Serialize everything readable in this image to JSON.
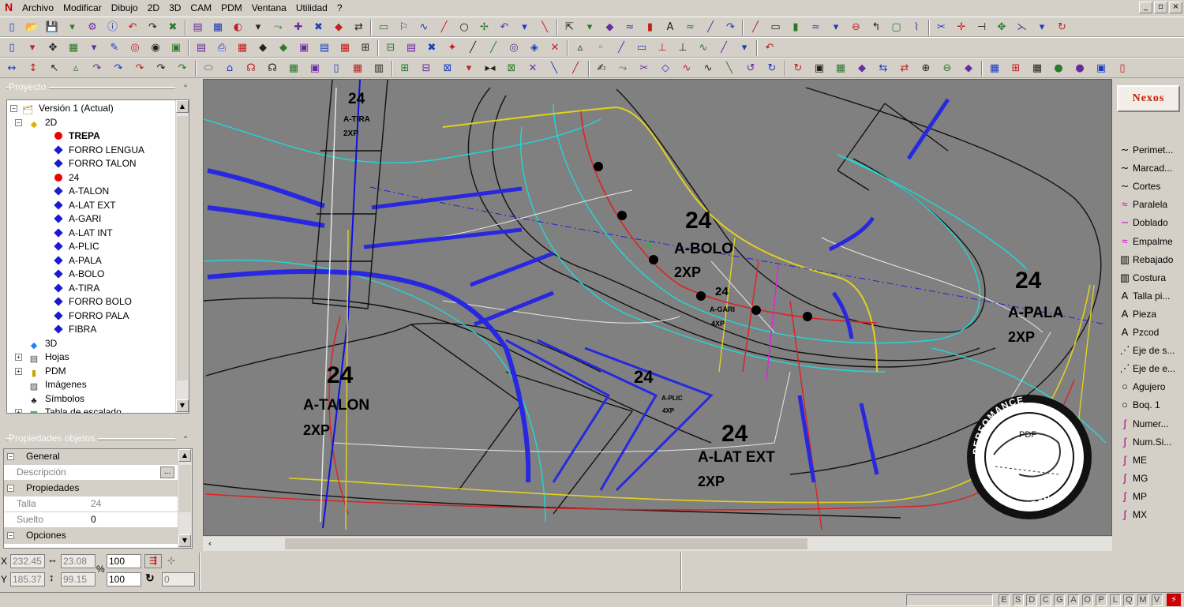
{
  "menu": [
    "Archivo",
    "Modificar",
    "Dibujo",
    "2D",
    "3D",
    "CAM",
    "PDM",
    "Ventana",
    "Utilidad",
    "?"
  ],
  "app_logo_glyph": "N",
  "panels": {
    "project_title": "Proyecto",
    "props_title": "Propiedades objetos"
  },
  "tree": [
    {
      "label": "Versión 1 (Actual)",
      "kind": "version",
      "depth": 0
    },
    {
      "label": "2D",
      "kind": "folder2d",
      "depth": 1
    },
    {
      "label": "TREPA",
      "kind": "circle",
      "depth": 2,
      "bold": true
    },
    {
      "label": "FORRO LENGUA",
      "kind": "diamond",
      "depth": 2
    },
    {
      "label": "FORRO TALON",
      "kind": "diamond",
      "depth": 2
    },
    {
      "label": "24",
      "kind": "circle",
      "depth": 2
    },
    {
      "label": "A-TALON",
      "kind": "diamond",
      "depth": 2
    },
    {
      "label": "A-LAT EXT",
      "kind": "diamond",
      "depth": 2
    },
    {
      "label": "A-GARI",
      "kind": "diamond",
      "depth": 2
    },
    {
      "label": "A-LAT INT",
      "kind": "diamond",
      "depth": 2
    },
    {
      "label": "A-PLIC",
      "kind": "diamond",
      "depth": 2
    },
    {
      "label": "A-PALA",
      "kind": "diamond",
      "depth": 2
    },
    {
      "label": "A-BOLO",
      "kind": "diamond",
      "depth": 2
    },
    {
      "label": "A-TIRA",
      "kind": "diamond",
      "depth": 2
    },
    {
      "label": "FORRO BOLO",
      "kind": "diamond",
      "depth": 2
    },
    {
      "label": "FORRO PALA",
      "kind": "diamond",
      "depth": 2
    },
    {
      "label": "FIBRA",
      "kind": "diamond",
      "depth": 2
    },
    {
      "label": "3D",
      "kind": "cube",
      "depth": 1
    },
    {
      "label": "Hojas",
      "kind": "sheet",
      "depth": 1
    },
    {
      "label": "PDM",
      "kind": "folder",
      "depth": 1
    },
    {
      "label": "Imágenes",
      "kind": "image",
      "depth": 1
    },
    {
      "label": "Símbolos",
      "kind": "symbol",
      "depth": 1
    },
    {
      "label": "Tabla de escalado",
      "kind": "table",
      "depth": 1
    }
  ],
  "props": [
    {
      "section": true,
      "label": "General"
    },
    {
      "key": "Descripción",
      "value": "",
      "ellipsis": "..."
    },
    {
      "section": true,
      "label": "Propiedades"
    },
    {
      "key": "Talla",
      "value": "24"
    },
    {
      "key": "Suelto",
      "value": "0"
    },
    {
      "section": true,
      "label": "Opciones"
    }
  ],
  "right_tools": [
    {
      "label": "Perimet...",
      "icon": "∼",
      "color": "#000"
    },
    {
      "label": "Marcad...",
      "icon": "∼",
      "color": "#000"
    },
    {
      "label": "Cortes",
      "icon": "∼",
      "color": "#000"
    },
    {
      "label": "Paralela",
      "icon": "≈",
      "color": "#d000d0"
    },
    {
      "label": "Doblado",
      "icon": "∼",
      "color": "#d000d0"
    },
    {
      "label": "Empalme",
      "icon": "≈",
      "color": "#d000d0"
    },
    {
      "label": "Rebajado",
      "icon": "▥",
      "color": "#000"
    },
    {
      "label": "Costura",
      "icon": "▥",
      "color": "#000"
    },
    {
      "label": "Talla pi...",
      "icon": "A",
      "color": "#000"
    },
    {
      "label": "Pieza",
      "icon": "A",
      "color": "#000"
    },
    {
      "label": "Pzcod",
      "icon": "A",
      "color": "#000"
    },
    {
      "label": "Eje de s...",
      "icon": "⋰",
      "color": "#000"
    },
    {
      "label": "Eje de e...",
      "icon": "⋰",
      "color": "#000"
    },
    {
      "label": "Agujero",
      "icon": "○",
      "color": "#000"
    },
    {
      "label": "Boq. 1",
      "icon": "○",
      "color": "#000"
    },
    {
      "label": "Numer...",
      "icon": "∫",
      "color": "#a0007a"
    },
    {
      "label": "Num.Si...",
      "icon": "∫",
      "color": "#a0007a"
    },
    {
      "label": "ME",
      "icon": "∫",
      "color": "#a0007a"
    },
    {
      "label": "MG",
      "icon": "∫",
      "color": "#a0007a"
    },
    {
      "label": "MP",
      "icon": "∫",
      "color": "#a0007a"
    },
    {
      "label": "MX",
      "icon": "∫",
      "color": "#a0007a"
    }
  ],
  "coords": {
    "x_label": "X",
    "y_label": "Y",
    "x": "232.45",
    "y": "185.37",
    "w": "23.08",
    "h": "99.15",
    "pct_label": "%",
    "scale1": "100",
    "scale2": "100",
    "angle": "0"
  },
  "status_letters": [
    "E",
    "S",
    "D",
    "C",
    "G",
    "A",
    "O",
    "P",
    "L",
    "Q",
    "M",
    "V"
  ],
  "canvas": {
    "labels": [
      {
        "text": "24",
        "size": 19
      },
      {
        "text": "A-TIRA",
        "size": 10
      },
      {
        "text": "2XP",
        "size": 10
      },
      {
        "text": "24",
        "size": 30
      },
      {
        "text": "A-BOLO",
        "size": 19
      },
      {
        "text": "2XP",
        "size": 18
      },
      {
        "text": "24",
        "size": 15
      },
      {
        "text": "A-GARI",
        "size": 9
      },
      {
        "text": "4XP",
        "size": 9
      },
      {
        "text": "24",
        "size": 30
      },
      {
        "text": "A-PALA",
        "size": 19
      },
      {
        "text": "2XP",
        "size": 18
      },
      {
        "text": "24",
        "size": 30
      },
      {
        "text": "A-TALON",
        "size": 19
      },
      {
        "text": "2XP",
        "size": 18
      },
      {
        "text": "24",
        "size": 22
      },
      {
        "text": "A-PLIC",
        "size": 8
      },
      {
        "text": "4XP",
        "size": 8
      },
      {
        "text": "24",
        "size": 30
      },
      {
        "text": "A-LAT EXT",
        "size": 19
      },
      {
        "text": "2XP",
        "size": 18
      }
    ],
    "stamp": {
      "top": "PERFOMANCE",
      "mid": "PDF",
      "bottom": "PATRON"
    }
  },
  "brand_logo": "Nexos"
}
